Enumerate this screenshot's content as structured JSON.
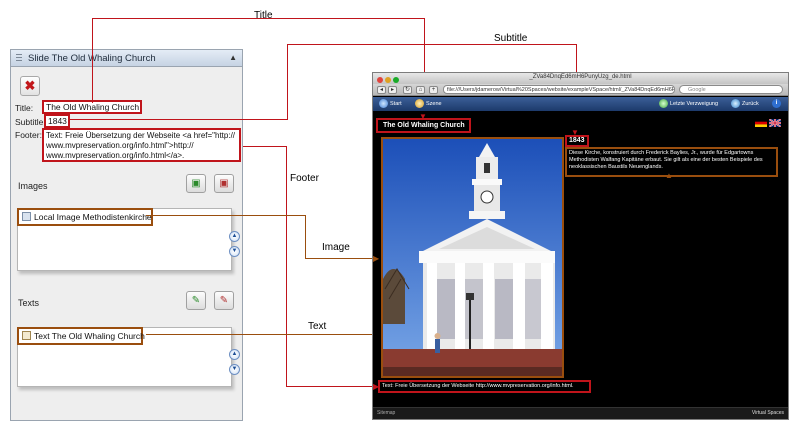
{
  "panel": {
    "title": "Slide The Old Whaling Church",
    "title_label": "Title:",
    "title_value": "The Old Whaling Church",
    "subtitle_label": "Subtitle:",
    "subtitle_value": "1843",
    "footer_label": "Footer:",
    "footer_lines": [
      "Text: Freie Übersetzung der Webseite <a href=\"http://",
      "www.mvpreservation.org/info.html\">http://",
      "www.mvpreservation.org/info.html</a>."
    ],
    "images_label": "Images",
    "image_item": "Local Image Methodistenkirche",
    "texts_label": "Texts",
    "text_item": "Text The Old Whaling Church"
  },
  "annotations": {
    "title": "Title",
    "subtitle": "Subtitle",
    "footer": "Footer",
    "image": "Image",
    "text": "Text"
  },
  "browser": {
    "window_title": "_ZVa84DnqEd6mH6PunyUzg_de.html",
    "url": "file:///Users/jdamerow/Virtual%20Spaces/website/exampleVSpace/html/_ZVa84DnqEd6mH6PunyUzg_de.html",
    "search_placeholder": "Google",
    "nav": {
      "start": "Start",
      "scene": "Szene",
      "last_branch": "Letzte Verzweigung",
      "back": "Zurück"
    },
    "slide_title": "The Old Whaling Church",
    "slide_subtitle": "1843",
    "slide_text": "Diese Kirche, konstruiert durch Frederick Baylies, Jr., wurde für Edgartowns Methodisten Walfang Kapitäne erbaut. Sie gilt als eine der besten Beispiele des neoklassischen Baustils Neuenglands.",
    "slide_footer": "Text: Freie Übersetzung der Webseite http://www.mvpreservation.org/info.html.",
    "bottom_left": "Sitemap",
    "bottom_right": "Virtual Spaces"
  },
  "colors": {
    "highlight_red": "#c0141b",
    "highlight_brown": "#9a4e0e",
    "slide_bg": "#000000",
    "nav_bg": "#2a4a80"
  }
}
